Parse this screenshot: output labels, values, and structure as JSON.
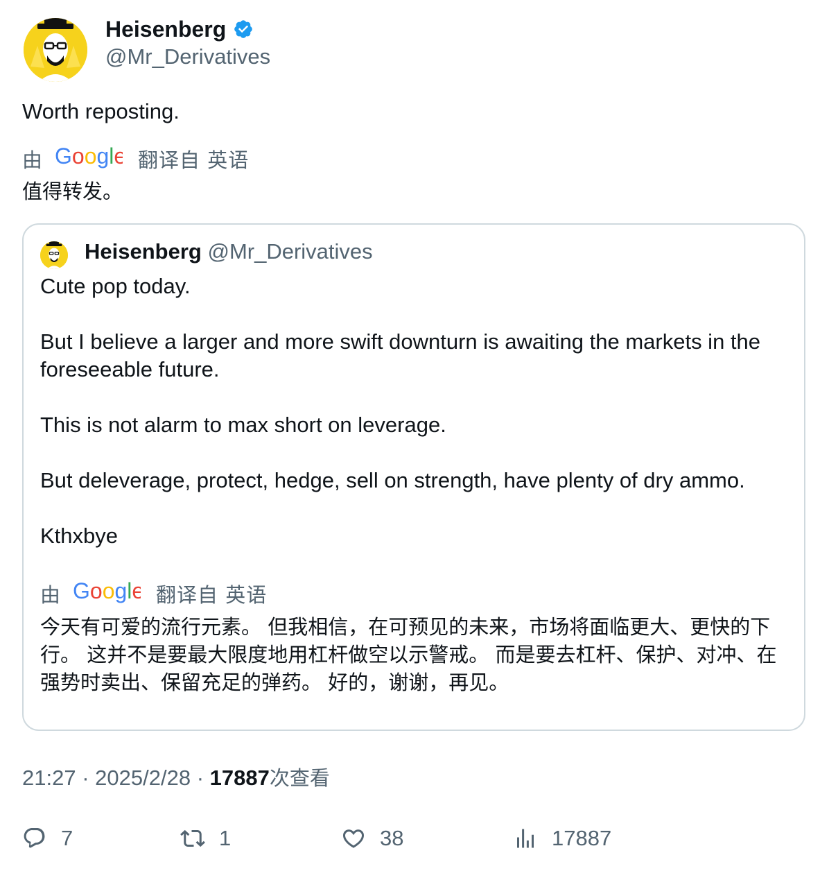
{
  "author": {
    "name": "Heisenberg",
    "handle": "@Mr_Derivatives",
    "verified_icon": "verified-badge-icon",
    "avatar_color": "#f6d21c"
  },
  "tweet": {
    "text": "Worth reposting.",
    "translation": {
      "by": "由",
      "provider": "Google",
      "from_label": "翻译自 英语",
      "text": "值得转发。"
    }
  },
  "quote": {
    "name": "Heisenberg",
    "handle": "@Mr_Derivatives",
    "paragraphs": [
      "Cute pop today.",
      "",
      "But I believe a larger and more swift downturn is awaiting the markets in the foreseeable future.",
      "",
      "This is not alarm to max short on leverage.",
      "",
      "But deleverage, protect, hedge, sell on strength, have plenty of dry ammo.",
      "",
      "Kthxbye",
      ""
    ],
    "translation": {
      "by": "由",
      "provider": "Google",
      "from_label": "翻译自 英语",
      "text": "今天有可爱的流行元素。 但我相信，在可预见的未来，市场将面临更大、更快的下行。 这并不是要最大限度地用杠杆做空以示警戒。 而是要去杠杆、保护、对冲、在强势时卖出、保留充足的弹药。 好的，谢谢，再见。"
    }
  },
  "meta": {
    "time": "21:27",
    "separator": "·",
    "date": "2025/2/28",
    "views_count": "17887",
    "views_label": "次查看"
  },
  "actions": {
    "replies": "7",
    "reposts": "1",
    "likes": "38",
    "views": "17887"
  },
  "colors": {
    "text": "#0f1419",
    "muted": "#536471",
    "border": "#cfd9de",
    "verified": "#1d9bf0"
  }
}
